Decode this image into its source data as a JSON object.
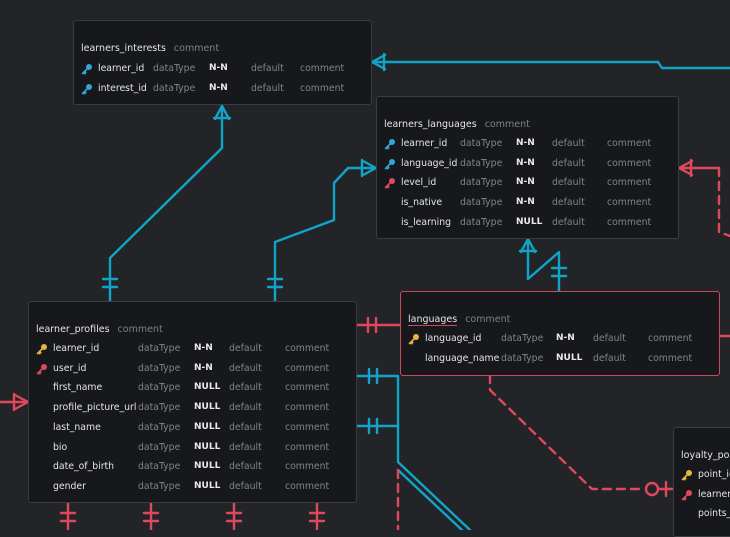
{
  "colors": {
    "background": "#232427",
    "card": "#17181b",
    "relation_blue": "#11a4c9",
    "relation_red": "#e0485f",
    "primary_key_gold": "#e8b53d",
    "foreign_key_blue": "#2ea9d6",
    "foreign_key_red": "#e0485f"
  },
  "tables": {
    "learners_interests": {
      "name": "learners_interests",
      "comment": "comment",
      "columns": [
        {
          "name": "learner_id",
          "type": "dataType",
          "nullable": "N-N",
          "default": "default",
          "comment": "comment",
          "key": "fk-blue"
        },
        {
          "name": "interest_id",
          "type": "dataType",
          "nullable": "N-N",
          "default": "default",
          "comment": "comment",
          "key": "fk-blue"
        }
      ]
    },
    "learners_languages": {
      "name": "learners_languages",
      "comment": "comment",
      "columns": [
        {
          "name": "learner_id",
          "type": "dataType",
          "nullable": "N-N",
          "default": "default",
          "comment": "comment",
          "key": "fk-blue"
        },
        {
          "name": "language_id",
          "type": "dataType",
          "nullable": "N-N",
          "default": "default",
          "comment": "comment",
          "key": "fk-blue"
        },
        {
          "name": "level_id",
          "type": "dataType",
          "nullable": "N-N",
          "default": "default",
          "comment": "comment",
          "key": "fk-red"
        },
        {
          "name": "is_native",
          "type": "dataType",
          "nullable": "N-N",
          "default": "default",
          "comment": "comment",
          "key": ""
        },
        {
          "name": "is_learning",
          "type": "dataType",
          "nullable": "NULL",
          "default": "default",
          "comment": "comment",
          "key": ""
        }
      ]
    },
    "languages": {
      "name": "languages",
      "comment": "comment",
      "columns": [
        {
          "name": "language_id",
          "type": "dataType",
          "nullable": "N-N",
          "default": "default",
          "comment": "comment",
          "key": "pk"
        },
        {
          "name": "language_name",
          "type": "dataType",
          "nullable": "NULL",
          "default": "default",
          "comment": "comment",
          "key": ""
        }
      ]
    },
    "learner_profiles": {
      "name": "learner_profiles",
      "comment": "comment",
      "columns": [
        {
          "name": "learner_id",
          "type": "dataType",
          "nullable": "N-N",
          "default": "default",
          "comment": "comment",
          "key": "pk"
        },
        {
          "name": "user_id",
          "type": "dataType",
          "nullable": "N-N",
          "default": "default",
          "comment": "comment",
          "key": "fk-red"
        },
        {
          "name": "first_name",
          "type": "dataType",
          "nullable": "NULL",
          "default": "default",
          "comment": "comment",
          "key": ""
        },
        {
          "name": "profile_picture_url",
          "type": "dataType",
          "nullable": "NULL",
          "default": "default",
          "comment": "comment",
          "key": ""
        },
        {
          "name": "last_name",
          "type": "dataType",
          "nullable": "NULL",
          "default": "default",
          "comment": "comment",
          "key": ""
        },
        {
          "name": "bio",
          "type": "dataType",
          "nullable": "NULL",
          "default": "default",
          "comment": "comment",
          "key": ""
        },
        {
          "name": "date_of_birth",
          "type": "dataType",
          "nullable": "NULL",
          "default": "default",
          "comment": "comment",
          "key": ""
        },
        {
          "name": "gender",
          "type": "dataType",
          "nullable": "NULL",
          "default": "default",
          "comment": "comment",
          "key": ""
        }
      ]
    },
    "loyalty_points": {
      "name": "loyalty_poi",
      "comment": "",
      "columns": [
        {
          "name": "point_id",
          "type": "",
          "nullable": "",
          "default": "",
          "comment": "",
          "key": "pk"
        },
        {
          "name": "learner_",
          "type": "",
          "nullable": "",
          "default": "",
          "comment": "",
          "key": "fk-red"
        },
        {
          "name": "points_e",
          "type": "",
          "nullable": "",
          "default": "",
          "comment": "",
          "key": ""
        }
      ]
    }
  }
}
